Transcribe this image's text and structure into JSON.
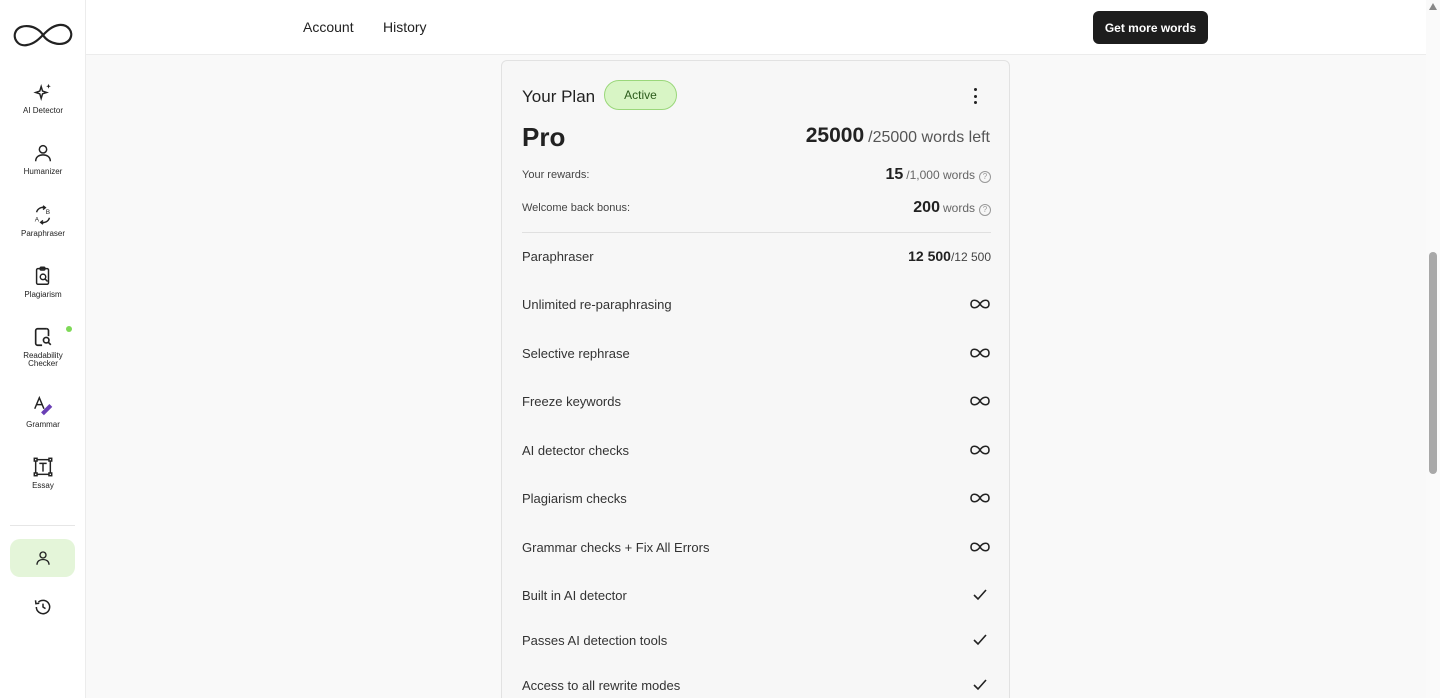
{
  "sidebar": {
    "items": [
      {
        "label": "AI Detector",
        "icon": "sparkle-icon"
      },
      {
        "label": "Humanizer",
        "icon": "person-icon"
      },
      {
        "label": "Paraphraser",
        "icon": "paraphrase-icon"
      },
      {
        "label": "Plagiarism",
        "icon": "clipboard-search-icon"
      },
      {
        "label": "Readability Checker",
        "icon": "doc-search-icon"
      },
      {
        "label": "Grammar",
        "icon": "grammar-icon"
      },
      {
        "label": "Essay",
        "icon": "text-frame-icon"
      }
    ],
    "accent": "#7ed957",
    "active_bg": "#e4f5d9"
  },
  "header": {
    "tabs": [
      {
        "label": "Account"
      },
      {
        "label": "History"
      }
    ],
    "cta_label": "Get more words"
  },
  "plan": {
    "title": "Your Plan",
    "status": "Active",
    "name": "Pro",
    "words_remaining": "25000",
    "words_total_text": "/25000 words left",
    "rewards": {
      "label": "Your rewards:",
      "value": "15",
      "unit": "/1,000 words"
    },
    "bonus": {
      "label": "Welcome back bonus:",
      "value": "200",
      "unit": "words"
    },
    "paraphraser": {
      "label": "Paraphraser",
      "value": "12 500",
      "total": "/12 500"
    },
    "features": [
      {
        "label": "Unlimited re-paraphrasing",
        "icon": "infinity-icon"
      },
      {
        "label": "Selective rephrase",
        "icon": "infinity-icon"
      },
      {
        "label": "Freeze keywords",
        "icon": "infinity-icon"
      },
      {
        "label": "AI detector checks",
        "icon": "infinity-icon"
      },
      {
        "label": "Plagiarism checks",
        "icon": "infinity-icon"
      },
      {
        "label": "Grammar checks + Fix All Errors",
        "icon": "infinity-icon"
      },
      {
        "label": "Built in AI detector",
        "icon": "check-icon"
      },
      {
        "label": "Passes AI detection tools",
        "icon": "check-icon"
      },
      {
        "label": "Access to all rewrite modes",
        "icon": "check-icon"
      }
    ]
  }
}
